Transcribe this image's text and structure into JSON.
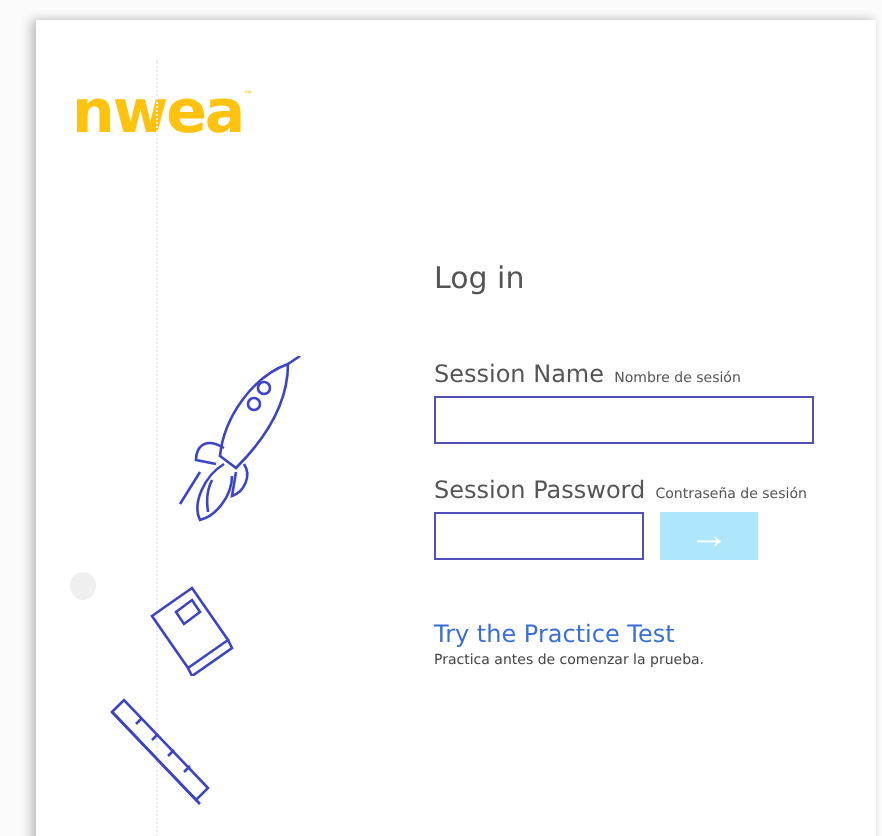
{
  "logo": {
    "text": "nwea",
    "trademark": "™"
  },
  "login": {
    "title": "Log in",
    "fields": [
      {
        "kind": "text",
        "label": "Session Name",
        "sublabel": "Nombre de sesión"
      },
      {
        "kind": "password",
        "label": "Session Password",
        "sublabel": "Contraseña de sesión"
      }
    ],
    "submit": {
      "icon": "→",
      "disabled": true
    }
  },
  "practice": {
    "link": "Try the Practice Test",
    "caption": "Practica antes de comenzar la prueba."
  }
}
